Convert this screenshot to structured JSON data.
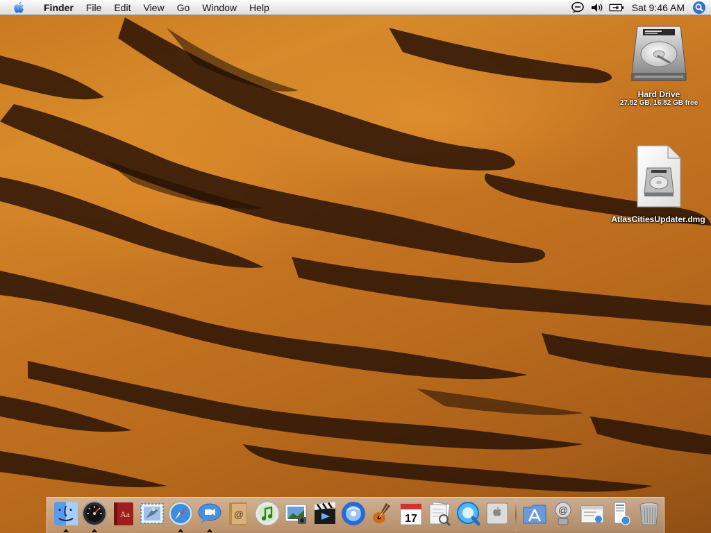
{
  "menubar": {
    "app_name": "Finder",
    "menus": [
      "File",
      "Edit",
      "View",
      "Go",
      "Window",
      "Help"
    ],
    "clock": "Sat 9:46 AM"
  },
  "desktop": {
    "icons": [
      {
        "label": "Hard Drive",
        "subtitle": "27.82 GB, 16.82 GB free",
        "icon": "hard-drive-icon"
      },
      {
        "label": "AtlasCitiesUpdater.dmg",
        "icon": "disk-image-icon"
      }
    ]
  },
  "dock": {
    "apps": [
      {
        "icon": "finder-icon",
        "running": true
      },
      {
        "icon": "dashboard-icon",
        "running": true
      },
      {
        "icon": "dictionary-icon",
        "running": false
      },
      {
        "icon": "mail-icon",
        "running": false
      },
      {
        "icon": "safari-icon",
        "running": true
      },
      {
        "icon": "ichat-icon",
        "running": true
      },
      {
        "icon": "address-book-icon",
        "running": false
      },
      {
        "icon": "itunes-icon",
        "running": false
      },
      {
        "icon": "iphoto-icon",
        "running": false
      },
      {
        "icon": "imovie-icon",
        "running": false
      },
      {
        "icon": "idvd-icon",
        "running": false
      },
      {
        "icon": "garageband-icon",
        "running": false
      },
      {
        "icon": "ical-icon",
        "running": false,
        "day": "17"
      },
      {
        "icon": "preview-icon",
        "running": false
      },
      {
        "icon": "quicktime-icon",
        "running": false
      },
      {
        "icon": "system-preferences-icon",
        "running": false
      }
    ],
    "docs": [
      {
        "icon": "applications-folder-icon"
      },
      {
        "icon": "network-icon"
      },
      {
        "icon": "window-icon"
      },
      {
        "icon": "file-icon"
      },
      {
        "icon": "trash-icon"
      }
    ]
  },
  "colors": {
    "wallpaper_base": "#c47320",
    "stripe": "#2a1306",
    "menubar": "#e9e9e9",
    "spotlight": "#2f6fd6"
  }
}
